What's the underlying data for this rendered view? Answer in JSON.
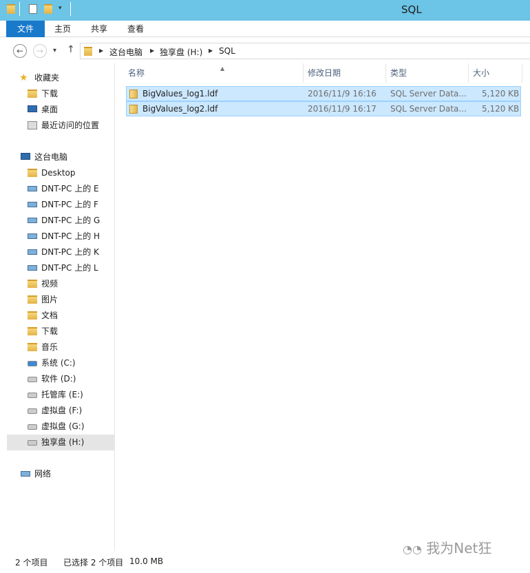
{
  "window": {
    "title": "SQL"
  },
  "ribbon": {
    "tabs": [
      "文件",
      "主页",
      "共享",
      "查看"
    ]
  },
  "address": {
    "crumbs": [
      "这台电脑",
      "独享盘 (H:)",
      "SQL"
    ]
  },
  "sidebar": {
    "favorites": {
      "label": "收藏夹",
      "items": [
        "下载",
        "桌面",
        "最近访问的位置"
      ]
    },
    "computer": {
      "label": "这台电脑",
      "items": [
        "Desktop",
        "DNT-PC 上的 E",
        "DNT-PC 上的 F",
        "DNT-PC 上的 G",
        "DNT-PC 上的 H",
        "DNT-PC 上的 K",
        "DNT-PC 上的 L",
        "视频",
        "图片",
        "文档",
        "下载",
        "音乐",
        "系统 (C:)",
        "软件 (D:)",
        "托管库 (E:)",
        "虚拟盘 (F:)",
        "虚拟盘 (G:)",
        "独享盘 (H:)"
      ]
    },
    "network": {
      "label": "网络"
    }
  },
  "columns": {
    "name": "名称",
    "modified": "修改日期",
    "type": "类型",
    "size": "大小"
  },
  "files": [
    {
      "name": "BigValues_log1.ldf",
      "modified": "2016/11/9 16:16",
      "type": "SQL Server Data...",
      "size": "5,120 KB"
    },
    {
      "name": "BigValues_log2.ldf",
      "modified": "2016/11/9 16:17",
      "type": "SQL Server Data...",
      "size": "5,120 KB"
    }
  ],
  "status": {
    "count": "2 个项目",
    "selected": "已选择 2 个项目",
    "size": "10.0 MB"
  },
  "watermark": "我为Net狂"
}
